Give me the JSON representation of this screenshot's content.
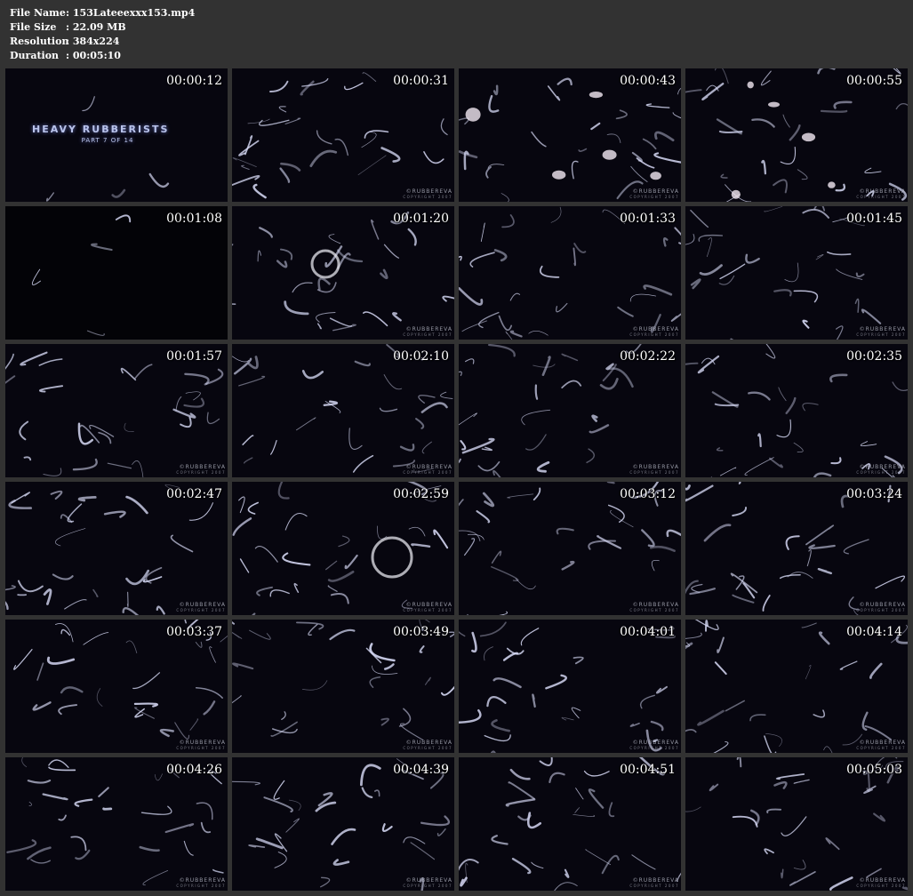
{
  "file_info": {
    "file_name_label": "File Name",
    "file_name_value": ":  153Lateeexxx153.mp4",
    "file_size_label": "File Size",
    "file_size_value": ":  22.09 MB",
    "resolution_label": "Resolution",
    "resolution_value": ":  384x224",
    "duration_label": "Duration",
    "duration_value": ":  00:05:10"
  },
  "title_card": {
    "title": "HEAVY RUBBERISTS",
    "part": "PART 7 OF 14"
  },
  "watermark": {
    "brand": "©RUBBEREVA",
    "copyright": "COPYRIGHT 2007"
  },
  "colors": {
    "background": "#323232",
    "text": "#ffffff",
    "frame_base": "#05040c",
    "latex_highlight": "#d6d9f5"
  },
  "thumbnails": [
    {
      "time": "00:00:12"
    },
    {
      "time": "00:00:31"
    },
    {
      "time": "00:00:43"
    },
    {
      "time": "00:00:55"
    },
    {
      "time": "00:01:08"
    },
    {
      "time": "00:01:20"
    },
    {
      "time": "00:01:33"
    },
    {
      "time": "00:01:45"
    },
    {
      "time": "00:01:57"
    },
    {
      "time": "00:02:10"
    },
    {
      "time": "00:02:22"
    },
    {
      "time": "00:02:35"
    },
    {
      "time": "00:02:47"
    },
    {
      "time": "00:02:59"
    },
    {
      "time": "00:03:12"
    },
    {
      "time": "00:03:24"
    },
    {
      "time": "00:03:37"
    },
    {
      "time": "00:03:49"
    },
    {
      "time": "00:04:01"
    },
    {
      "time": "00:04:14"
    },
    {
      "time": "00:04:26"
    },
    {
      "time": "00:04:39"
    },
    {
      "time": "00:04:51"
    },
    {
      "time": "00:05:03"
    }
  ]
}
